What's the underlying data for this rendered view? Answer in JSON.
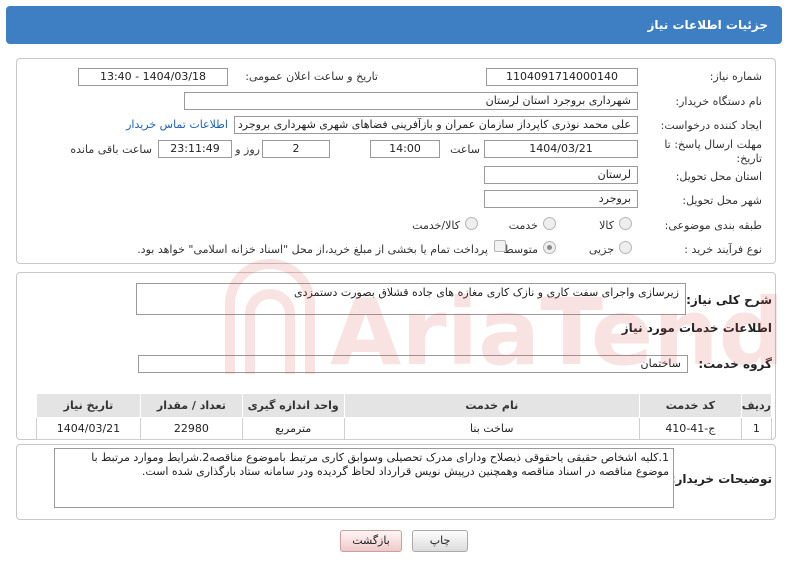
{
  "header": {
    "title": "جزئیات اطلاعات نیاز"
  },
  "form": {
    "need_number_label": "شماره نیاز:",
    "need_number": "1104091714000140",
    "announce_label": "تاریخ و ساعت اعلان عمومی:",
    "announce_value": "1404/03/18 - 13:40",
    "buyer_org_label": "نام دستگاه خریدار:",
    "buyer_org": "شهرداری بروجرد استان لرستان",
    "creator_label": "ایجاد کننده درخواست:",
    "creator": "علی محمد نوذری کاپرداز سازمان عمران و بازآفرینی فضاهای شهری شهرداری بروجرد",
    "contact_link": "اطلاعات تماس خریدار",
    "deadline_label": "مهلت ارسال پاسخ: تا تاریخ:",
    "deadline_date": "1404/03/21",
    "time_label": "ساعت",
    "deadline_time": "14:00",
    "days_value": "2",
    "days_label": "روز و",
    "remaining_time": "23:11:49",
    "remaining_label": "ساعت باقی مانده",
    "province_label": "استان محل تحویل:",
    "province": "لرستان",
    "city_label": "شهر محل تحویل:",
    "city": "بروجرد",
    "category_label": "طبقه بندی موضوعی:",
    "category_options": [
      "کالا",
      "خدمت",
      "کالا/خدمت"
    ],
    "process_label": "نوع فرآیند خرید :",
    "process_options": [
      "جزیی",
      "متوسط"
    ],
    "payment_note": "پرداخت تمام یا بخشی از مبلغ خرید،از محل \"اسناد خزانه اسلامی\" خواهد بود."
  },
  "description": {
    "label": "شرح کلی نیاز:",
    "text": "زیرسازی واجرای سفت کاری و نازک کاری مغازه های جاده قشلاق بصورت دستمزدی"
  },
  "services": {
    "section_title": "اطلاعات خدمات مورد نیاز",
    "group_label": "گروه خدمت:",
    "group_value": "ساختمان",
    "columns": [
      "ردیف",
      "کد خدمت",
      "نام خدمت",
      "واحد اندازه گیری",
      "تعداد / مقدار",
      "تاریخ نیاز"
    ],
    "rows": [
      [
        "1",
        "ج-41-410",
        "ساخت بنا",
        "مترمربع",
        "22980",
        "1404/03/21"
      ]
    ]
  },
  "buyer_notes": {
    "label": "توضیحات خریدار:",
    "text": "1.کلیه اشخاص حقیقی یاحقوقی ذیصلاح ودارای مدرک تحصیلی وسوابق کاری مرتبط باموضوع مناقصه2.شرایط وموارد مرتبط با موضوع مناقصه در اسناد مناقصه وهمچنین درپیش نویس قرارداد لحاظ گردیده ودر سامانه ستاد بارگذاری شده است."
  },
  "buttons": {
    "print": "چاپ",
    "back": "بازگشت"
  },
  "colors": {
    "header_bg": "#3e7fc4",
    "link": "#1f62b5",
    "watermark": "#d9534f"
  }
}
